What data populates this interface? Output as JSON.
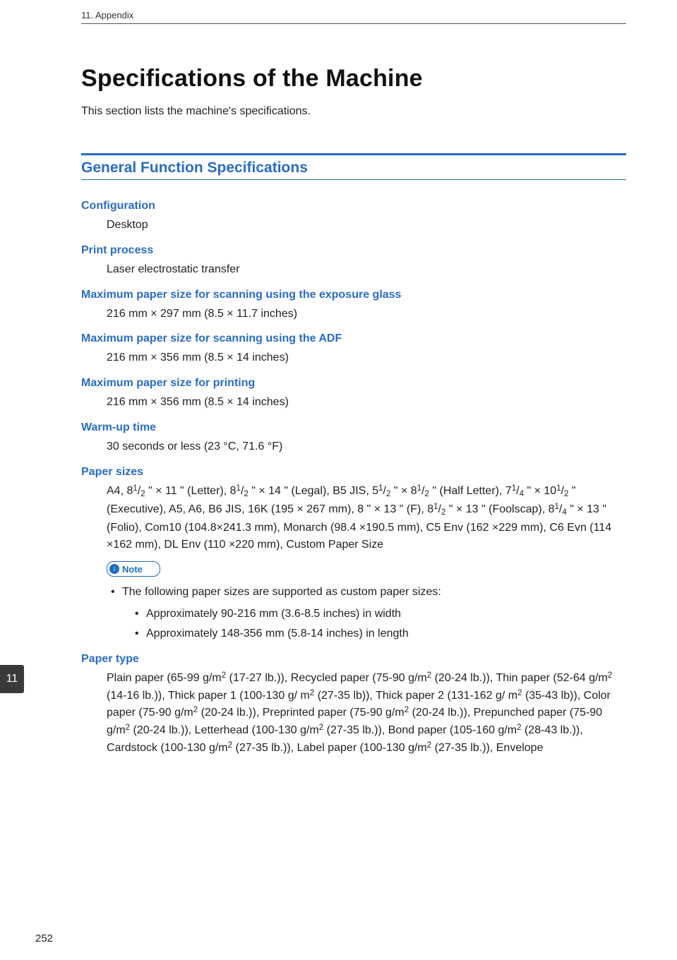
{
  "running_head": "11. Appendix",
  "title": "Specifications of the Machine",
  "intro": "This section lists the machine's specifications.",
  "section_heading": "General Function Specifications",
  "specs": {
    "configuration": {
      "label": "Configuration",
      "value": "Desktop"
    },
    "print_process": {
      "label": "Print process",
      "value": "Laser electrostatic transfer"
    },
    "max_scan_glass": {
      "label": "Maximum paper size for scanning using the exposure glass",
      "value": "216 mm × 297 mm (8.5 × 11.7 inches)"
    },
    "max_scan_adf": {
      "label": "Maximum paper size for scanning using the ADF",
      "value": "216 mm × 356 mm (8.5 × 14 inches)"
    },
    "max_print": {
      "label": "Maximum paper size for printing",
      "value": "216 mm × 356 mm (8.5 × 14 inches)"
    },
    "warmup": {
      "label": "Warm-up time",
      "value": "30 seconds or less (23 °C, 71.6 °F)"
    },
    "paper_sizes": {
      "label": "Paper sizes",
      "value_html": "A4, 8<span class='frac'><span class='num'>1</span>/<span class='den'>2</span></span> \" × 11 \" (Letter), 8<span class='frac'><span class='num'>1</span>/<span class='den'>2</span></span> \" × 14 \" (Legal), B5 JIS, 5<span class='frac'><span class='num'>1</span>/<span class='den'>2</span></span> \" × 8<span class='frac'><span class='num'>1</span>/<span class='den'>2</span></span> \" (Half Letter), 7<span class='frac'><span class='num'>1</span>/<span class='den'>4</span></span> \" × 10<span class='frac'><span class='num'>1</span>/<span class='den'>2</span></span> \" (Executive), A5, A6, B6 JIS, 16K (195 × 267 mm), 8 \" × 13 \" (F), 8<span class='frac'><span class='num'>1</span>/<span class='den'>2</span></span> \" × 13 \" (Foolscap), 8<span class='frac'><span class='num'>1</span>/<span class='den'>4</span></span> \" × 13 \" (Folio), Com10 (104.8×241.3 mm), Monarch (98.4 ×190.5 mm), C5 Env (162 ×229 mm), C6 Evn (114 ×162 mm), DL Env (110 ×220 mm), Custom Paper Size"
    },
    "paper_type": {
      "label": "Paper type",
      "value_html": "Plain paper (65-99 g/m<sup>2</sup> (17-27 lb.)), Recycled paper (75-90 g/m<sup>2</sup> (20-24 lb.)), Thin paper (52-64 g/m<sup>2</sup> (14-16 lb.)), Thick paper 1 (100-130 g/ m<sup>2</sup> (27-35 lb)), Thick paper 2 (131-162 g/ m<sup>2</sup> (35-43 lb)), Color paper (75-90 g/m<sup>2</sup> (20-24 lb.)), Preprinted paper (75-90 g/m<sup>2</sup> (20-24 lb.)), Prepunched paper (75-90 g/m<sup>2</sup> (20-24 lb.)), Letterhead (100-130 g/m<sup>2</sup> (27-35 lb.)), Bond paper (105-160 g/m<sup>2</sup> (28-43 lb.)), Cardstock (100-130 g/m<sup>2</sup> (27-35 lb.)), Label paper (100-130 g/m<sup>2</sup> (27-35 lb.)), Envelope"
    }
  },
  "note": {
    "label": "Note",
    "intro": "The following paper sizes are supported as custom paper sizes:",
    "items": [
      "Approximately 90-216 mm (3.6-8.5 inches) in width",
      "Approximately 148-356 mm (5.8-14 inches) in length"
    ]
  },
  "tab_number": "11",
  "page_number": "252"
}
